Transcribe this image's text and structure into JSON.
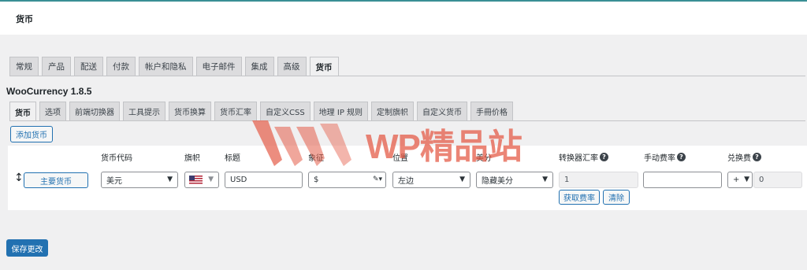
{
  "header": {
    "title": "货币"
  },
  "main_tabs": [
    {
      "label": "常规",
      "active": false
    },
    {
      "label": "产品",
      "active": false
    },
    {
      "label": "配送",
      "active": false
    },
    {
      "label": "付款",
      "active": false
    },
    {
      "label": "帐户和隐私",
      "active": false
    },
    {
      "label": "电子邮件",
      "active": false
    },
    {
      "label": "集成",
      "active": false
    },
    {
      "label": "高级",
      "active": false
    },
    {
      "label": "货币",
      "active": true
    }
  ],
  "plugin": {
    "name": "WooCurrency 1.8.5"
  },
  "sub_tabs": [
    {
      "label": "货币",
      "active": true
    },
    {
      "label": "选项",
      "active": false
    },
    {
      "label": "前端切换器",
      "active": false
    },
    {
      "label": "工具提示",
      "active": false
    },
    {
      "label": "货币换算",
      "active": false
    },
    {
      "label": "货币汇率",
      "active": false
    },
    {
      "label": "自定义CSS",
      "active": false
    },
    {
      "label": "地理 IP 规则",
      "active": false
    },
    {
      "label": "定制旗帜",
      "active": false
    },
    {
      "label": "自定义货币",
      "active": false
    },
    {
      "label": "手冊价格",
      "active": false
    }
  ],
  "actions": {
    "add_currency": "添加货币",
    "save": "保存更改"
  },
  "columns": {
    "code": "货币代码",
    "flag": "旗帜",
    "title": "标题",
    "symbol": "象征",
    "position": "位置",
    "cents": "美分",
    "rate": "转换器汇率",
    "manual_fee": "手动费率",
    "exchange_fee": "兑换费"
  },
  "row": {
    "main_button": "主要货币",
    "code": "美元",
    "title": "USD",
    "symbol": "$",
    "position": "左边",
    "cents": "隐藏美分",
    "rate": "1",
    "manual_fee": "",
    "fee_sign": "+",
    "fee_value": "0",
    "get_rate": "获取费率",
    "clear": "清除"
  },
  "watermark": {
    "text": "WP精品站"
  },
  "colors": {
    "primary": "#2271b1",
    "watermark": "#e45c48"
  }
}
